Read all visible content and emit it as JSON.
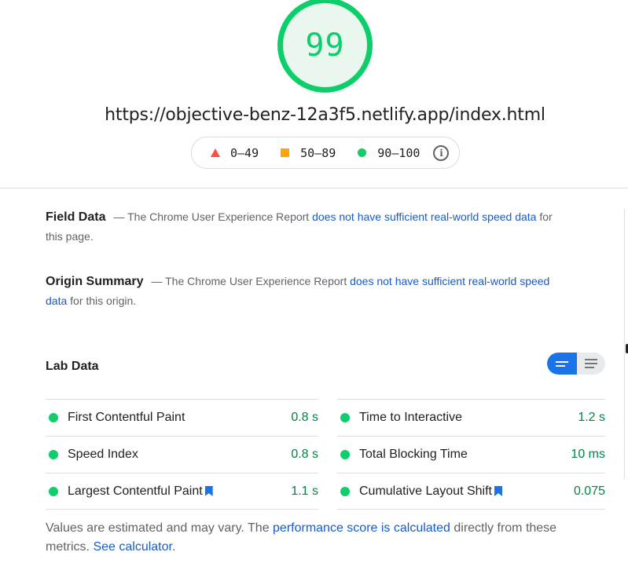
{
  "score": {
    "value": "99",
    "color": "#0cce6b"
  },
  "url": "https://objective-benz-12a3f5.netlify.app/index.html",
  "legend": {
    "fail": "0–49",
    "average": "50–89",
    "pass": "90–100",
    "info_icon": "info-icon"
  },
  "field_data": {
    "heading": "Field Data",
    "prefix": "— The Chrome User Experience Report ",
    "link": "does not have sufficient real-world speed data",
    "suffix": " for this page."
  },
  "origin_summary": {
    "heading": "Origin Summary",
    "prefix": "— The Chrome User Experience Report ",
    "link": "does not have sufficient real-world speed data",
    "suffix": " for this origin."
  },
  "lab_data": {
    "heading": "Lab Data",
    "view_toggle": {
      "selected": "compact-view",
      "options": [
        "compact-view",
        "expanded-view"
      ]
    },
    "metrics_left": [
      {
        "label": "First Contentful Paint",
        "value": "0.8 s",
        "bookmark": false
      },
      {
        "label": "Speed Index",
        "value": "0.8 s",
        "bookmark": false
      },
      {
        "label": "Largest Contentful Paint",
        "value": "1.1 s",
        "bookmark": true
      }
    ],
    "metrics_right": [
      {
        "label": "Time to Interactive",
        "value": "1.2 s",
        "bookmark": false
      },
      {
        "label": "Total Blocking Time",
        "value": "10 ms",
        "bookmark": false
      },
      {
        "label": "Cumulative Layout Shift",
        "value": "0.075",
        "bookmark": true
      }
    ]
  },
  "footnote": {
    "prefix": "Values are estimated and may vary. The ",
    "link1": "performance score is calculated",
    "middle": " directly from these metrics. ",
    "link2": "See calculator",
    "suffix": "."
  },
  "colors": {
    "pass": "#0cce6b",
    "average": "#ffa400",
    "fail": "#ff4e42",
    "link": "#1a5bc1",
    "toggle_active": "#1a73e8",
    "metric_value": "#018642"
  }
}
